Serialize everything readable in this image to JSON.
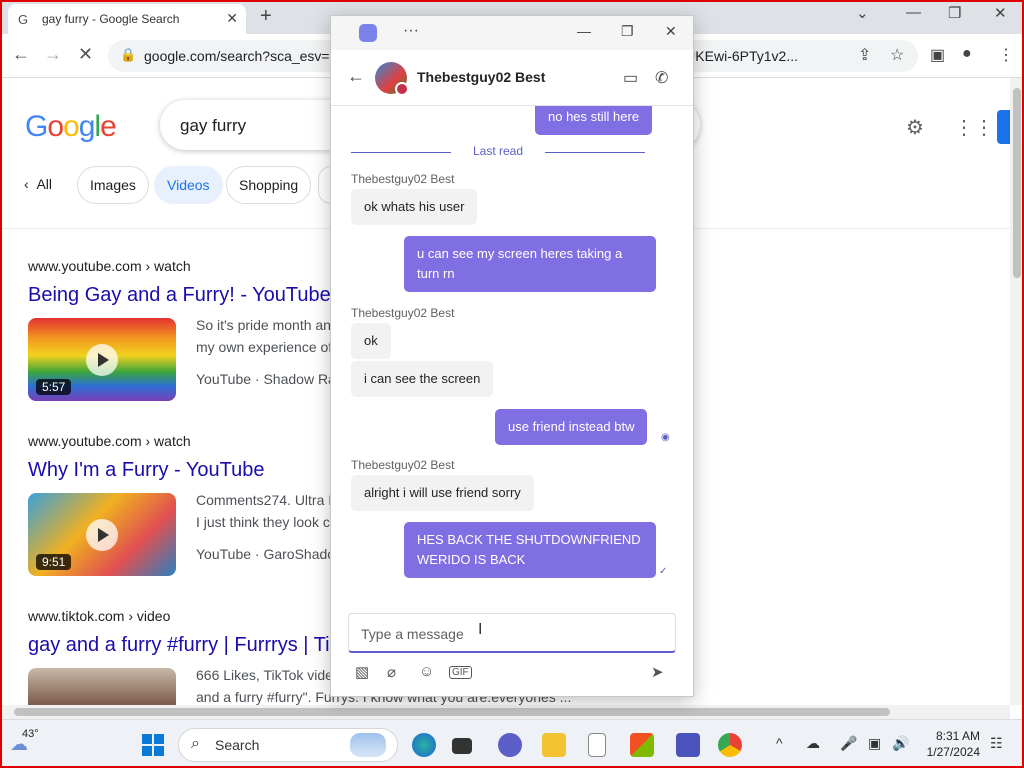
{
  "browser": {
    "tab_title": "gay furry - Google Search",
    "url_left": "google.com/search?sca_esv=6",
    "url_right": "ed=2ahUKEwi-6PTy1v2..."
  },
  "google": {
    "query": "gay furry",
    "all_label": "All",
    "chips": [
      "Images",
      "Videos",
      "Shopping"
    ],
    "active_chip": "Videos",
    "results": [
      {
        "url": "www.youtube.com › watch",
        "title": "Being Gay and a Furry! - YouTube",
        "duration": "5:57",
        "snippet1": "So it's pride month an",
        "snippet2": "my own experience of",
        "source": "YouTube · Shadow Ra"
      },
      {
        "url": "www.youtube.com › watch",
        "title": "Why I'm a Furry - YouTube",
        "duration": "9:51",
        "snippet1": "Comments274. Ultra I",
        "snippet2": "I just think they look c",
        "source": "YouTube · GaroShado"
      },
      {
        "url": "www.tiktok.com › video",
        "title": "gay and a furry #furry | Furrrys | Tik",
        "snippet1": "666 Likes, TikTok vide",
        "snippet2": "and a furry #furry\". Furrys. I know what you are.everyones ..."
      }
    ]
  },
  "teams": {
    "contact_name": "Thebestguy02 Best",
    "last_read": "Last read",
    "messages": [
      {
        "dir": "out",
        "text": "no hes still here"
      },
      {
        "dir": "in",
        "sender": "Thebestguy02 Best",
        "text": "ok whats his user"
      },
      {
        "dir": "out",
        "text": "u can see my screen heres taking a turn rn"
      },
      {
        "dir": "in",
        "sender": "Thebestguy02 Best",
        "text": "ok"
      },
      {
        "dir": "in",
        "text": "i can see the screen"
      },
      {
        "dir": "out",
        "text": "use friend instead btw"
      },
      {
        "dir": "in",
        "sender": "Thebestguy02 Best",
        "text": "alright i will use friend sorry"
      },
      {
        "dir": "out",
        "text": "HES BACK THE SHUTDOWNFRIEND WERIDO IS BACK"
      }
    ],
    "compose_placeholder": "Type a message"
  },
  "taskbar": {
    "temperature": "43°",
    "search_label": "Search",
    "time": "8:31 AM",
    "date": "1/27/2024"
  }
}
